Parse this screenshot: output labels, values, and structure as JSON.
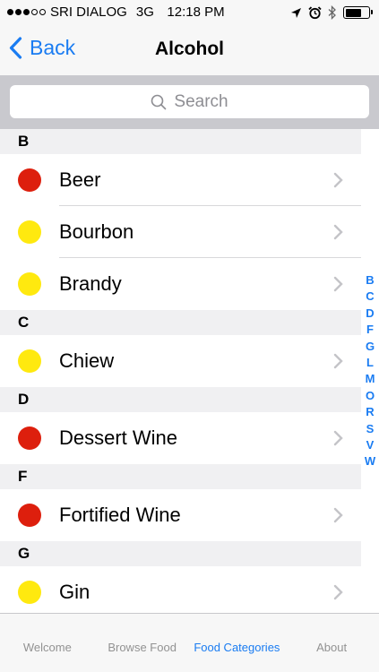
{
  "status_bar": {
    "carrier": "SRI DIALOG",
    "network": "3G",
    "time": "12:18 PM",
    "signal_strength": 3,
    "signal_max": 5,
    "battery_level": 0.7
  },
  "nav": {
    "back_label": "Back",
    "title": "Alcohol"
  },
  "search": {
    "placeholder": "Search"
  },
  "colors": {
    "accent": "#1a7cf2",
    "red": "#dd1f0d",
    "yellow": "#ffe90f"
  },
  "sections": [
    {
      "letter": "B",
      "items": [
        {
          "label": "Beer",
          "color": "red"
        },
        {
          "label": "Bourbon",
          "color": "yellow"
        },
        {
          "label": "Brandy",
          "color": "yellow"
        }
      ]
    },
    {
      "letter": "C",
      "items": [
        {
          "label": "Chiew",
          "color": "yellow"
        }
      ]
    },
    {
      "letter": "D",
      "items": [
        {
          "label": "Dessert Wine",
          "color": "red"
        }
      ]
    },
    {
      "letter": "F",
      "items": [
        {
          "label": "Fortified Wine",
          "color": "red"
        }
      ]
    },
    {
      "letter": "G",
      "items": [
        {
          "label": "Gin",
          "color": "yellow"
        }
      ]
    }
  ],
  "index_letters": [
    "B",
    "C",
    "D",
    "F",
    "G",
    "L",
    "M",
    "O",
    "R",
    "S",
    "V",
    "W"
  ],
  "tabs": [
    {
      "label": "Welcome",
      "active": false
    },
    {
      "label": "Browse Food",
      "active": false
    },
    {
      "label": "Food Categories",
      "active": true
    },
    {
      "label": "About",
      "active": false
    }
  ]
}
